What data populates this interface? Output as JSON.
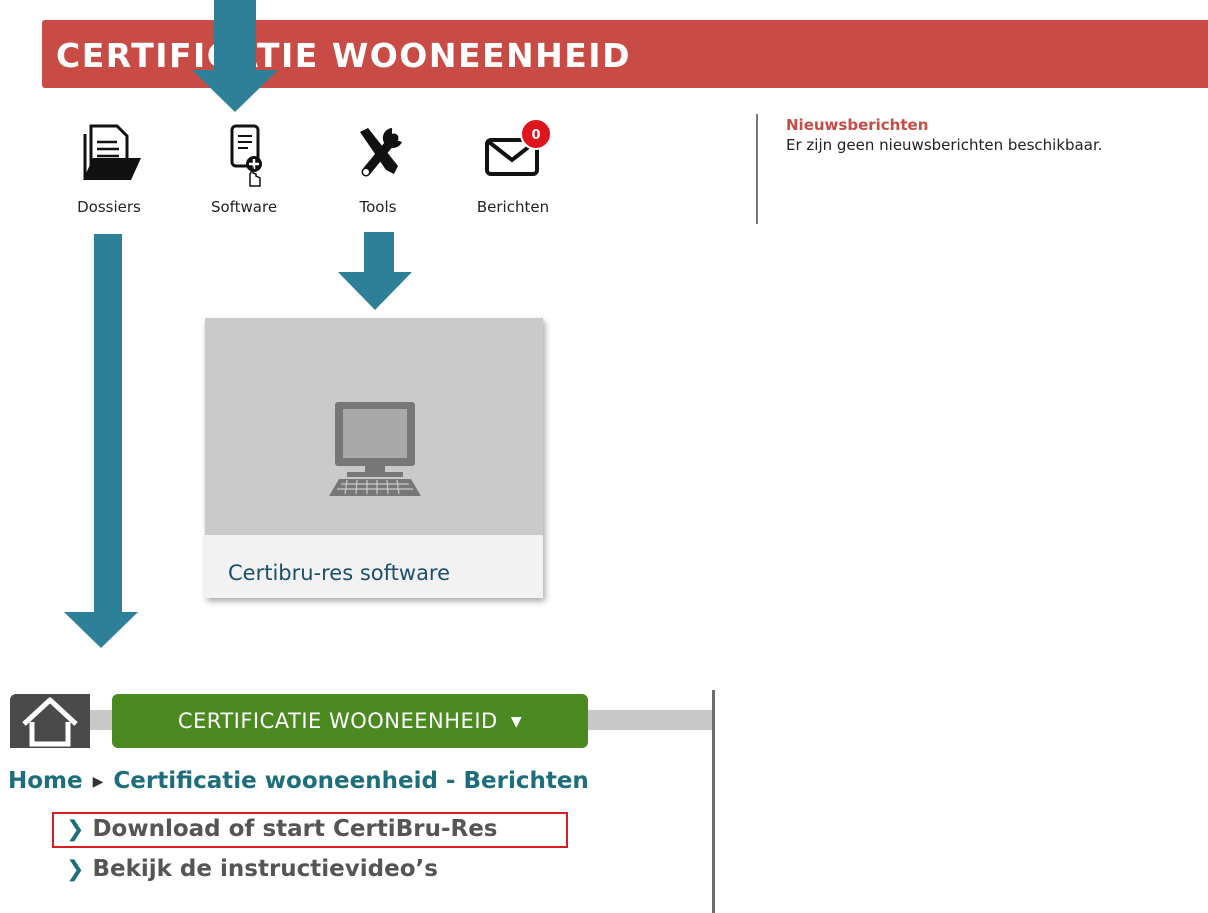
{
  "header": {
    "title": "CERTIFICATIE WOONEENHEID"
  },
  "nav": [
    {
      "label": "Dossiers",
      "icon": "folder-icon"
    },
    {
      "label": "Software",
      "icon": "document-add-icon"
    },
    {
      "label": "Tools",
      "icon": "tools-icon"
    },
    {
      "label": "Berichten",
      "icon": "mail-icon",
      "badge": "0"
    }
  ],
  "news": {
    "title": "Nieuwsberichten",
    "text": "Er zijn geen nieuwsberichten beschikbaar."
  },
  "card": {
    "title": "Certibru-res software",
    "icon": "computer-icon"
  },
  "bottom": {
    "section_button": "CERTIFICATIE WOONEENHEID",
    "breadcrumb": {
      "home": "Home",
      "current": "Certificatie wooneenheid - Berichten"
    },
    "links": [
      "Download of start CertiBru-Res",
      "Bekijk de instructievideo’s"
    ]
  },
  "colors": {
    "banner": "#c94b45",
    "arrow": "#2e7f98",
    "green": "#4a8a20",
    "link": "#1d6e7d",
    "highlight": "#d81e22"
  }
}
